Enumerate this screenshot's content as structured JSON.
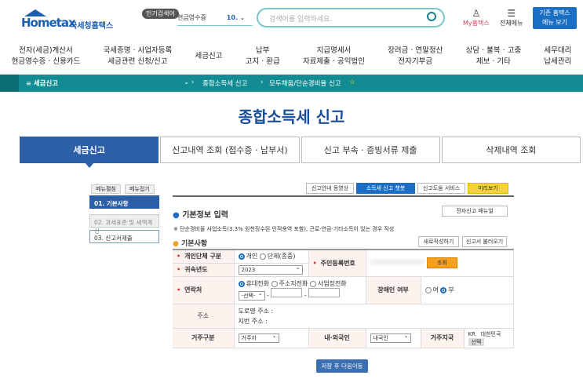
{
  "header": {
    "logo_text": "Hometax",
    "logo_korean": "국세청홈택스",
    "popular_label": "인기검색어",
    "keyword": "현금영수증",
    "keyword_rank": "10.",
    "search_placeholder": "검색어를 입력하세요.",
    "my_label": "My홈택스",
    "all_menu_label": "전체메뉴",
    "old_menu_line1": "기존 홈택스",
    "old_menu_line2": "메뉴 보기"
  },
  "nav": [
    [
      "전자(세금)계산서",
      "현금영수증 · 신용카드"
    ],
    [
      "국세증명 · 사업자등록",
      "세금관련 신청/신고"
    ],
    [
      "세금신고",
      ""
    ],
    [
      "납부",
      "고지 · 환급"
    ],
    [
      "지급명세서",
      "자료제출 · 공익법인"
    ],
    [
      "장려금 · 연말정산",
      "전자기부금"
    ],
    [
      "상담 · 불복 · 고충",
      "제보 · 기타"
    ],
    [
      "세무대리",
      "납세관리"
    ]
  ],
  "breadcrumb": {
    "menu": "세금신고",
    "level2": "종합소득세 신고",
    "level3": "모두채움/단순경비율 신고"
  },
  "page_title": "종합소득세 신고",
  "tabs": [
    "세금신고",
    "신고내역 조회 (접수증 · 납부서)",
    "신고 부속 · 증빙서류 제출",
    "삭제내역 조회"
  ],
  "sidebar": {
    "expand": "메뉴펼침",
    "collapse": "메뉴접기",
    "steps": [
      "01. 기본사항",
      "02. 과세표준 및 세액계산",
      "03. 신고서제출"
    ]
  },
  "toolbar": {
    "video": "신고안내 동영상",
    "chatbot": "소득세 신고 챗봇",
    "help": "신고도움 서비스",
    "preview": "미리보기"
  },
  "section": {
    "title": "기본정보 입력",
    "manual": "전자신고 매뉴얼",
    "notice": "※ 단순경비율 사업소득(3.3% 원천징수된 인적용역 포함), 근로·연금·기타소득이 있는 경우 작성",
    "sub_title": "기본사항",
    "new_write": "새로작성하기",
    "load": "신고서 불러오기"
  },
  "form": {
    "type_label": "개인단체 구분",
    "type_opts": [
      "개인",
      "단체(종중)"
    ],
    "year_label": "귀속년도",
    "year": "2023",
    "rrn_label": "주민등록번호",
    "rrn_btn": "조회",
    "contact_label": "연락처",
    "contact_opts": [
      "휴대전화",
      "주소지전화",
      "사업장전화"
    ],
    "contact_select": "-선택-",
    "disabled_label": "장애인 여부",
    "disabled_opts": [
      "여",
      "부"
    ],
    "addr_label": "주소",
    "road_addr": "도로명 주소 :",
    "lot_addr": "지번 주소 :",
    "residence_label": "거주구분",
    "residence": "거주자",
    "foreign_label": "내·외국인",
    "foreign": "내국인",
    "country_label": "거주지국",
    "country_code": "KR",
    "country": "대한민국",
    "country_btn": "선택"
  },
  "save_button": "저장 후 다음이동"
}
